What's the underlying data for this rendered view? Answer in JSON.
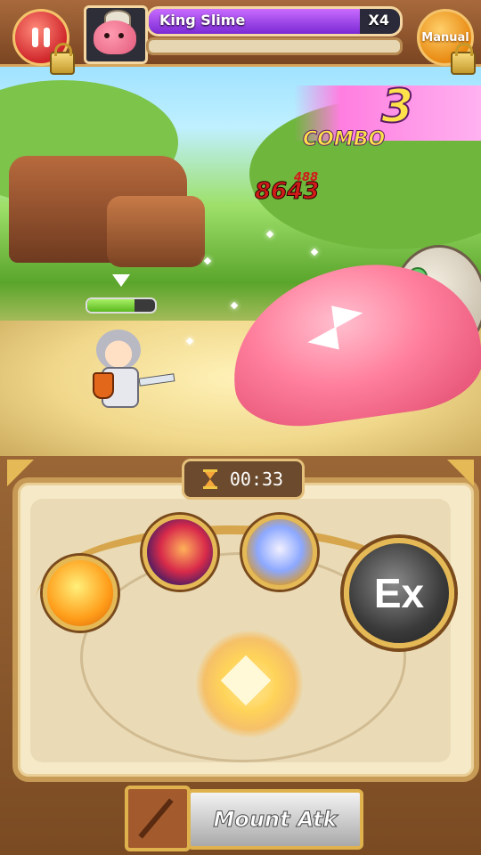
{
  "hud": {
    "boss_name": "King Slime",
    "boss_hp_multiplier": "X4",
    "boss_hp_fraction": 0.84,
    "manual_label": "Manual"
  },
  "battle": {
    "combo_count": "3",
    "combo_label": "COMBO",
    "damage_main": "8643",
    "damage_small": "488",
    "hero_hp_fraction": 0.7
  },
  "controls": {
    "timer": "00:33",
    "ex_label": "Ex",
    "mount_label": "Mount Atk"
  },
  "colors": {
    "boss_hp": "#7a29d4",
    "hero_hp": "#5ab81e",
    "combo_text": "#ffe24a",
    "damage_text": "#d11a1a"
  }
}
